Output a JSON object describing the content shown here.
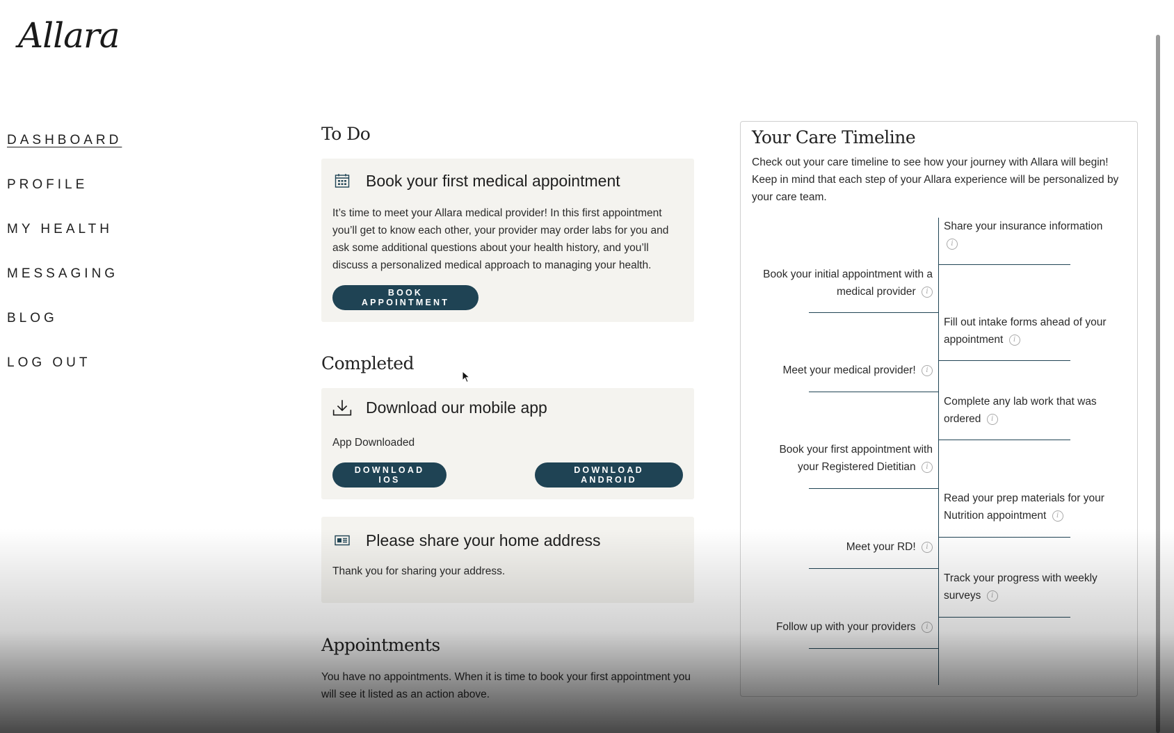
{
  "brand": {
    "logo": "Allara"
  },
  "nav": {
    "items": [
      {
        "label": "DASHBOARD"
      },
      {
        "label": "PROFILE"
      },
      {
        "label": "MY HEALTH"
      },
      {
        "label": "MESSAGING"
      },
      {
        "label": "BLOG"
      },
      {
        "label": "LOG OUT"
      }
    ],
    "active": "DASHBOARD"
  },
  "todo": {
    "title": "To Do",
    "card": {
      "icon": "calendar-icon",
      "title": "Book your first medical appointment",
      "text": "It’s time to meet your Allara medical provider! In this first appointment you’ll get to know each other, your provider may order labs for you and ask some additional questions about your health history, and you’ll discuss a personalized medical approach to managing your health.",
      "button": "BOOK APPOINTMENT"
    }
  },
  "completed": {
    "title": "Completed",
    "app_card": {
      "icon": "download-icon",
      "title": "Download our mobile app",
      "status": "App Downloaded",
      "ios_button": "DOWNLOAD IOS",
      "android_button": "DOWNLOAD ANDROID"
    },
    "address_card": {
      "icon": "address-card-icon",
      "title": "Please share your home address",
      "text": "Thank you for sharing your address."
    }
  },
  "appointments": {
    "title": "Appointments",
    "text": "You have no appointments. When it is time to book your first appointment you will see it listed as an action above."
  },
  "timeline": {
    "title": "Your Care Timeline",
    "intro": "Check out your care timeline to see how your journey with Allara will begin! Keep in mind that each step of your Allara experience will be personalized by your care team.",
    "steps": [
      {
        "text": "Share your insurance information",
        "side": "right"
      },
      {
        "text": "Book your initial appointment with a medical provider",
        "side": "left"
      },
      {
        "text": "Fill out intake forms ahead of your appointment",
        "side": "right"
      },
      {
        "text": "Meet your medical provider!",
        "side": "left"
      },
      {
        "text": "Complete any lab work that was ordered",
        "side": "right"
      },
      {
        "text": "Book your first appointment with your Registered Dietitian",
        "side": "left"
      },
      {
        "text": "Read your prep materials for your Nutrition appointment",
        "side": "right"
      },
      {
        "text": "Meet your RD!",
        "side": "left"
      },
      {
        "text": "Track your progress with weekly surveys",
        "side": "right"
      },
      {
        "text": "Follow up with your providers",
        "side": "left"
      }
    ],
    "info_glyph": "i"
  },
  "colors": {
    "accent": "#1f4354",
    "card_bg": "#f4f3ef",
    "line": "#1f4354"
  }
}
